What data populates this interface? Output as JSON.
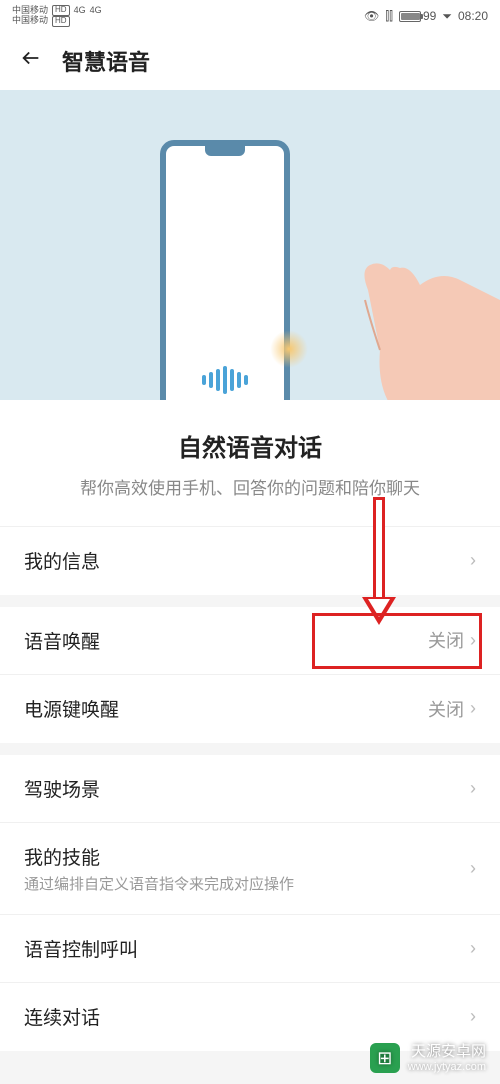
{
  "status": {
    "carrier": "中国移动",
    "net_label": "4G",
    "battery_pct": "99",
    "time": "08:20"
  },
  "header": {
    "title": "智慧语音"
  },
  "hero": {
    "title": "自然语音对话",
    "desc": "帮你高效使用手机、回答你的问题和陪你聊天"
  },
  "group1": {
    "items": [
      {
        "label": "我的信息",
        "value": ""
      }
    ]
  },
  "group2": {
    "items": [
      {
        "label": "语音唤醒",
        "value": "关闭"
      },
      {
        "label": "电源键唤醒",
        "value": "关闭"
      }
    ]
  },
  "group3": {
    "items": [
      {
        "label": "驾驶场景",
        "value": "",
        "sub": ""
      },
      {
        "label": "我的技能",
        "value": "",
        "sub": "通过编排自定义语音指令来完成对应操作"
      },
      {
        "label": "语音控制呼叫",
        "value": "",
        "sub": ""
      },
      {
        "label": "连续对话",
        "value": "",
        "sub": ""
      }
    ]
  },
  "watermark": {
    "name": "天源安卓网",
    "url": "www.jytyaz.com"
  }
}
